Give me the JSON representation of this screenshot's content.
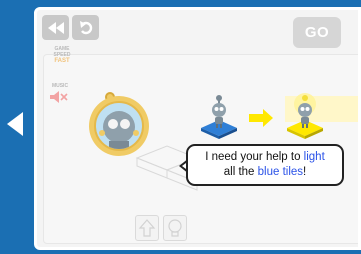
{
  "toolbar": {
    "rewind_icon": "rewind-icon",
    "undo_icon": "undo-icon",
    "go_label": "GO"
  },
  "settings": {
    "game_speed_label_1": "GAME",
    "game_speed_label_2": "SPEED",
    "game_speed_value": "FAST",
    "music_label": "MUSIC",
    "music_icon": "speaker-muted-icon"
  },
  "tutorial": {
    "text_before": "I need your help to ",
    "highlight_1": "light",
    "text_middle": "all the ",
    "highlight_2": "blue tiles",
    "text_after": "!"
  },
  "nav": {
    "back_icon": "left-arrow-icon"
  },
  "colors": {
    "rail_blue": "#1b6fb3",
    "tile_blue": "#2f7fd6",
    "lit_yellow": "#ffe800",
    "highlight_blue": "#2a52e8",
    "avatar_gold": "#f0cb65"
  }
}
